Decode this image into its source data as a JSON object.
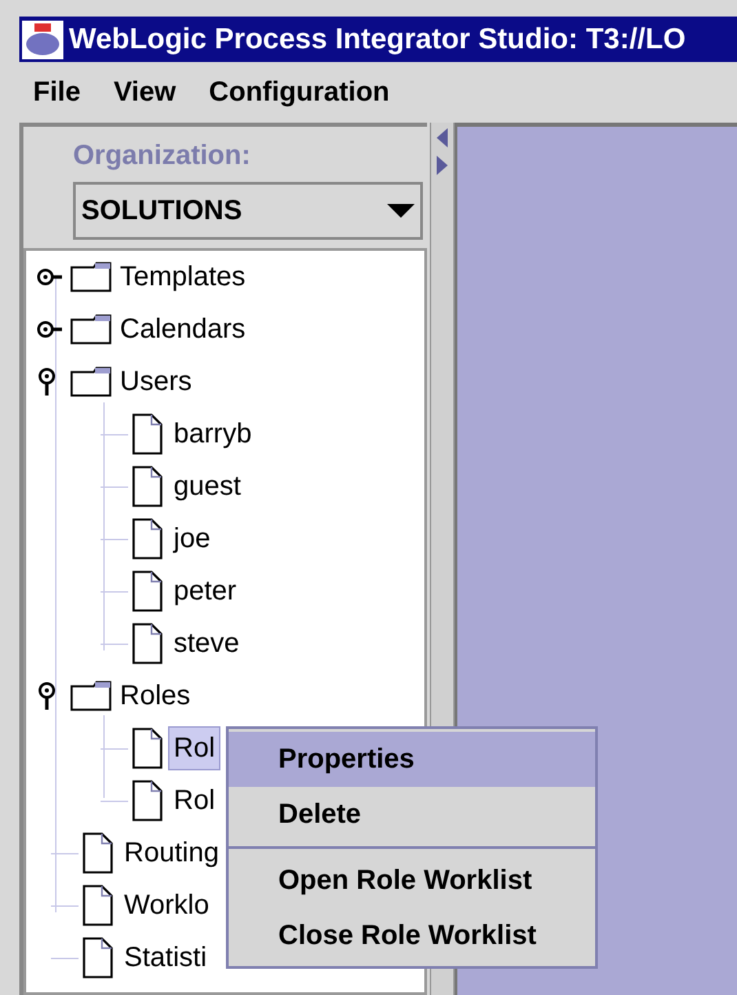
{
  "window": {
    "title": "WebLogic Process Integrator Studio: T3://LO"
  },
  "menu": [
    "File",
    "View",
    "Configuration"
  ],
  "organization": {
    "label": "Organization:",
    "value": "SOLUTIONS"
  },
  "tree": [
    {
      "label": "Templates",
      "kind": "folder",
      "expanded": false
    },
    {
      "label": "Calendars",
      "kind": "folder",
      "expanded": false
    },
    {
      "label": "Users",
      "kind": "folder",
      "expanded": true,
      "children": [
        {
          "label": "barryb",
          "kind": "item",
          "selected": false
        },
        {
          "label": "guest",
          "kind": "item",
          "selected": false
        },
        {
          "label": "joe",
          "kind": "item",
          "selected": false
        },
        {
          "label": "peter",
          "kind": "item",
          "selected": false
        },
        {
          "label": "steve",
          "kind": "item",
          "selected": false
        }
      ]
    },
    {
      "label": "Roles",
      "kind": "folder",
      "expanded": true,
      "children": [
        {
          "label": "Rol",
          "kind": "item",
          "selected": true
        },
        {
          "label": "Rol",
          "kind": "item",
          "selected": false
        }
      ]
    },
    {
      "label": "Routing",
      "kind": "item",
      "selected": false
    },
    {
      "label": "Worklo",
      "kind": "item",
      "selected": false
    },
    {
      "label": "Statisti",
      "kind": "item",
      "selected": false
    }
  ],
  "context_menu": [
    {
      "label": "Properties",
      "selected": true,
      "separator_after": false
    },
    {
      "label": "Delete",
      "selected": false,
      "separator_after": true
    },
    {
      "label": "Open Role Worklist",
      "selected": false,
      "separator_after": false
    },
    {
      "label": "Close Role Worklist",
      "selected": false,
      "separator_after": false
    }
  ]
}
